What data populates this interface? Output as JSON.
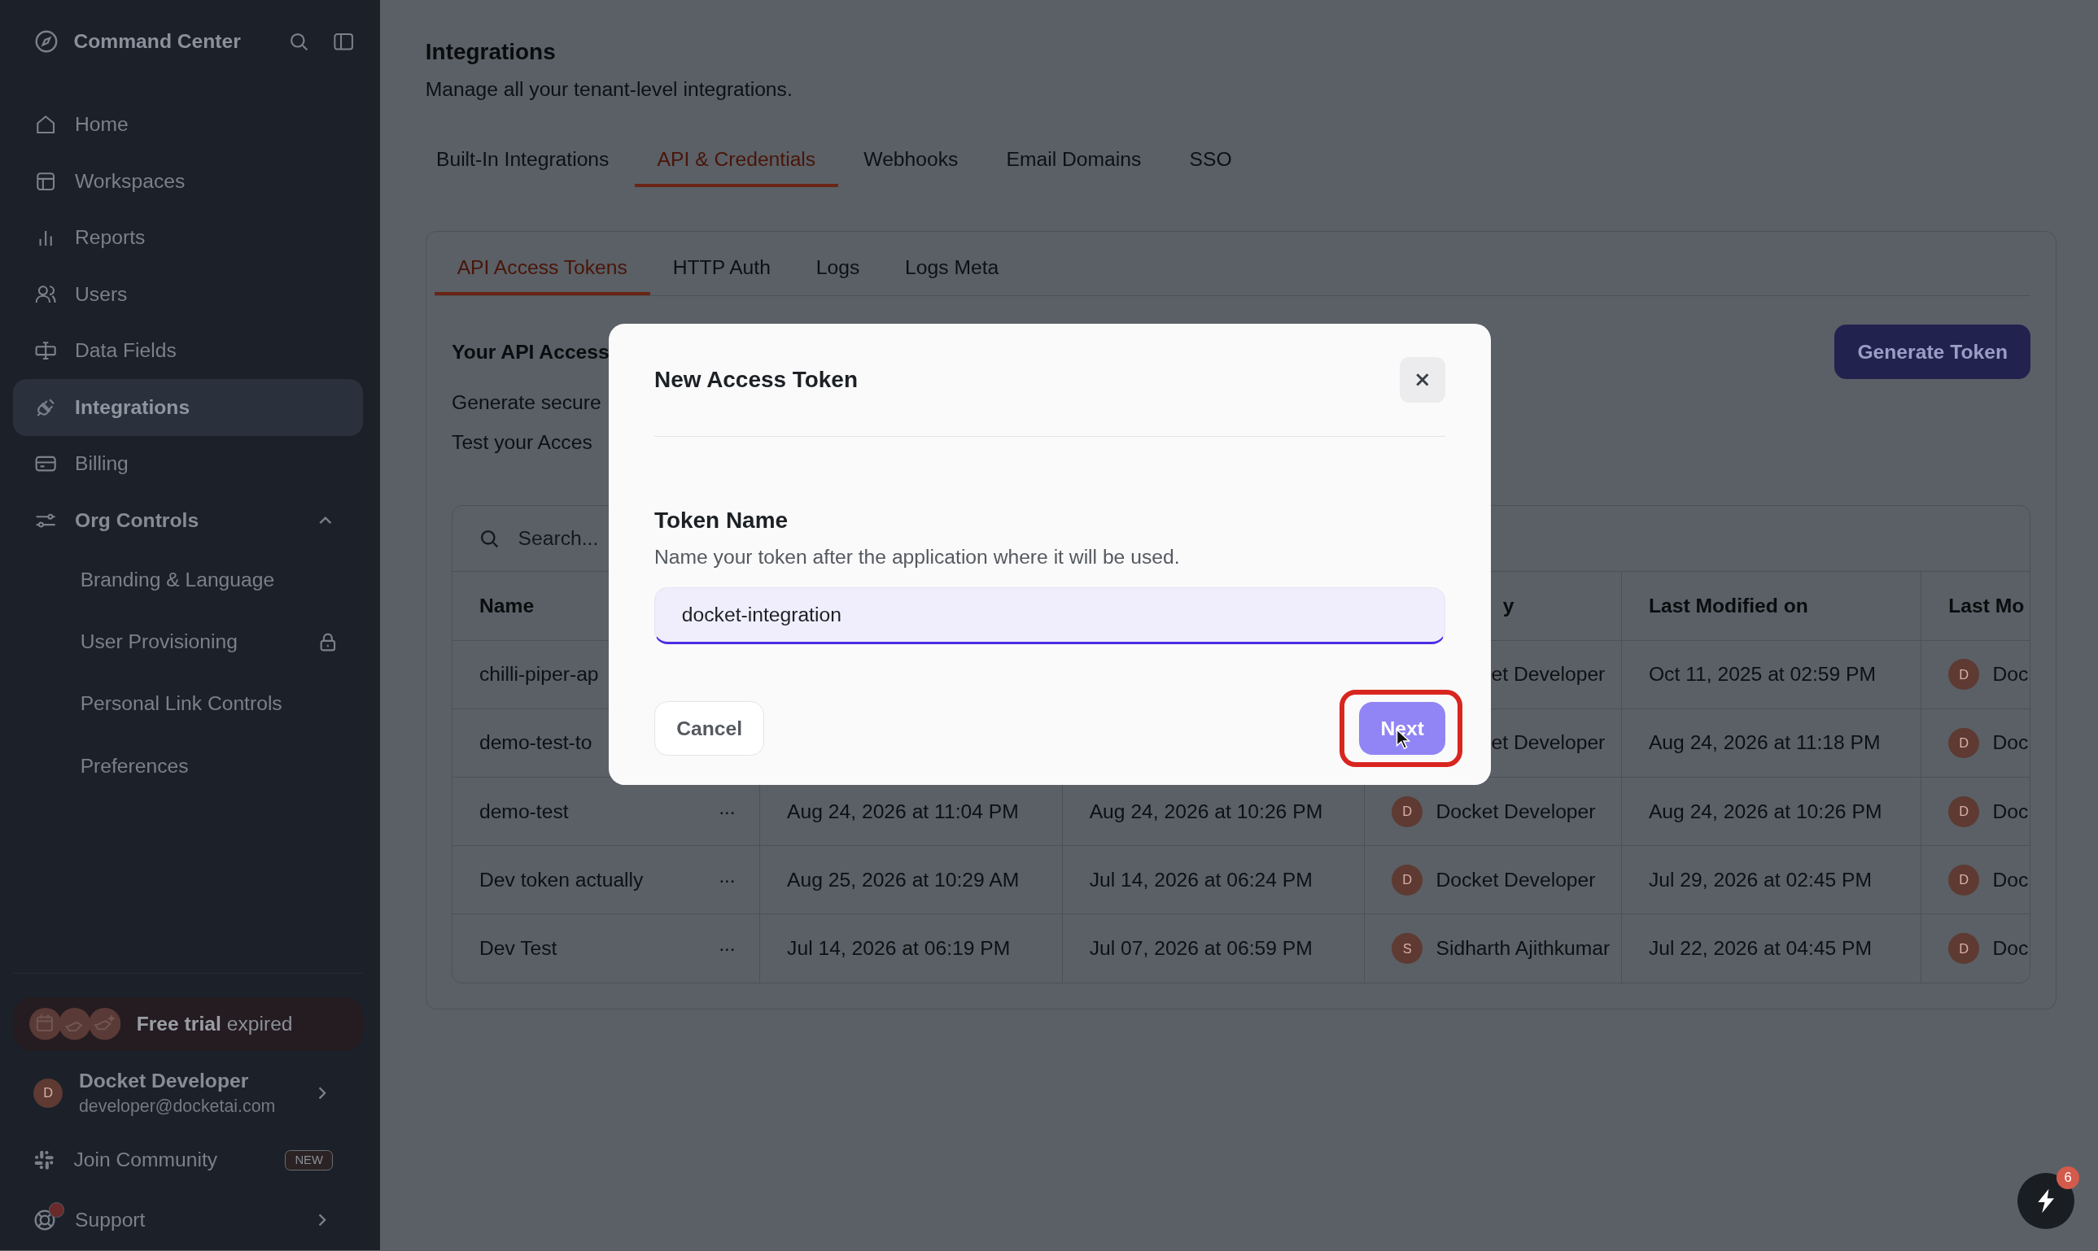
{
  "sidebar": {
    "title": "Command Center",
    "nav": [
      {
        "label": "Home",
        "kind": "home",
        "selected": false
      },
      {
        "label": "Workspaces",
        "kind": "layout",
        "selected": false
      },
      {
        "label": "Reports",
        "kind": "bars",
        "selected": false
      },
      {
        "label": "Users",
        "kind": "users",
        "selected": false
      },
      {
        "label": "Data Fields",
        "kind": "field",
        "selected": false
      },
      {
        "label": "Integrations",
        "kind": "plug",
        "selected": true
      },
      {
        "label": "Billing",
        "kind": "card",
        "selected": false
      },
      {
        "label": "Org Controls",
        "kind": "sliders",
        "selected": false,
        "expanded": true,
        "children": [
          {
            "label": "Branding & Language",
            "locked": false
          },
          {
            "label": "User Provisioning",
            "locked": true
          },
          {
            "label": "Personal Link Controls",
            "locked": false
          },
          {
            "label": "Preferences",
            "locked": false
          }
        ]
      }
    ],
    "trial_banner": {
      "text": "**Free trial** expired"
    },
    "user": {
      "initial": "D",
      "name": "Docket Developer",
      "email": "developer@docketai.com"
    },
    "community": {
      "label": "Join Community",
      "badge": "NEW"
    },
    "support": {
      "label": "Support",
      "notification": true
    }
  },
  "page": {
    "title": "Integrations",
    "subtitle": "Manage all your tenant-level integrations.",
    "tabs": [
      {
        "label": "Built-In Integrations",
        "selected": false
      },
      {
        "label": "API & Credentials",
        "selected": true
      },
      {
        "label": "Webhooks",
        "selected": false
      },
      {
        "label": "Email Domains",
        "selected": false
      },
      {
        "label": "SSO",
        "selected": false
      }
    ],
    "subtabs": [
      {
        "label": "API Access Tokens",
        "selected": true
      },
      {
        "label": "HTTP Auth",
        "selected": false
      },
      {
        "label": "Logs",
        "selected": false
      },
      {
        "label": "Logs Meta",
        "selected": false
      }
    ],
    "heading": "Your API Access",
    "lines": [
      "Generate secure",
      "Test your Acces"
    ],
    "generate_button": "Generate Token",
    "table": {
      "search_placeholder": "Search...",
      "columns": [
        "Name",
        "y",
        "Last Modified on",
        "Last Mo"
      ],
      "rows": [
        {
          "name": "chilli-piper-ap",
          "created_by": {
            "name": "et Developer"
          },
          "last_modified_on": "Oct 11, 2025 at 02:59 PM",
          "last_modified_by": {
            "initial": "D",
            "name": "Doc"
          }
        },
        {
          "name": "demo-test-to",
          "created_by": {
            "name": "et Developer"
          },
          "last_modified_on": "Aug 24, 2026 at 11:18 PM",
          "last_modified_by": {
            "initial": "D",
            "name": "Doc"
          }
        },
        {
          "name": "demo-test",
          "menu": "···",
          "column_3": "Aug 24, 2026 at 11:04 PM",
          "column_4": "Aug 24, 2026 at 10:26 PM",
          "created_by": {
            "initial": "D",
            "name": "Docket Developer"
          },
          "last_modified_on": "Aug 24, 2026 at 10:26 PM",
          "last_modified_by": {
            "initial": "D",
            "name": "Doc"
          }
        },
        {
          "name": "Dev token actually",
          "menu": "···",
          "column_3": "Aug 25, 2026 at 10:29 AM",
          "column_4": "Jul 14, 2026 at 06:24 PM",
          "created_by": {
            "initial": "D",
            "name": "Docket Developer"
          },
          "last_modified_on": "Jul 29, 2026 at 02:45 PM",
          "last_modified_by": {
            "initial": "D",
            "name": "Doc"
          }
        },
        {
          "name": "Dev Test",
          "menu": "···",
          "column_3": "Jul 14, 2026 at 06:19 PM",
          "column_4": "Jul 07, 2026 at 06:59 PM",
          "created_by": {
            "initial": "S",
            "name": "Sidharth Ajithkumar"
          },
          "last_modified_on": "Jul 22, 2026 at 04:45 PM",
          "last_modified_by": {
            "initial": "D",
            "name": "Doc"
          }
        }
      ]
    }
  },
  "modal": {
    "title": "New Access Token",
    "field_label": "Token Name",
    "help": "Name your token after the application where it will be used.",
    "value": "docket-integration",
    "focused": true,
    "cancel": "Cancel",
    "next": {
      "label": "Next",
      "highlighted": true
    }
  },
  "fab": {
    "badge": "6"
  }
}
